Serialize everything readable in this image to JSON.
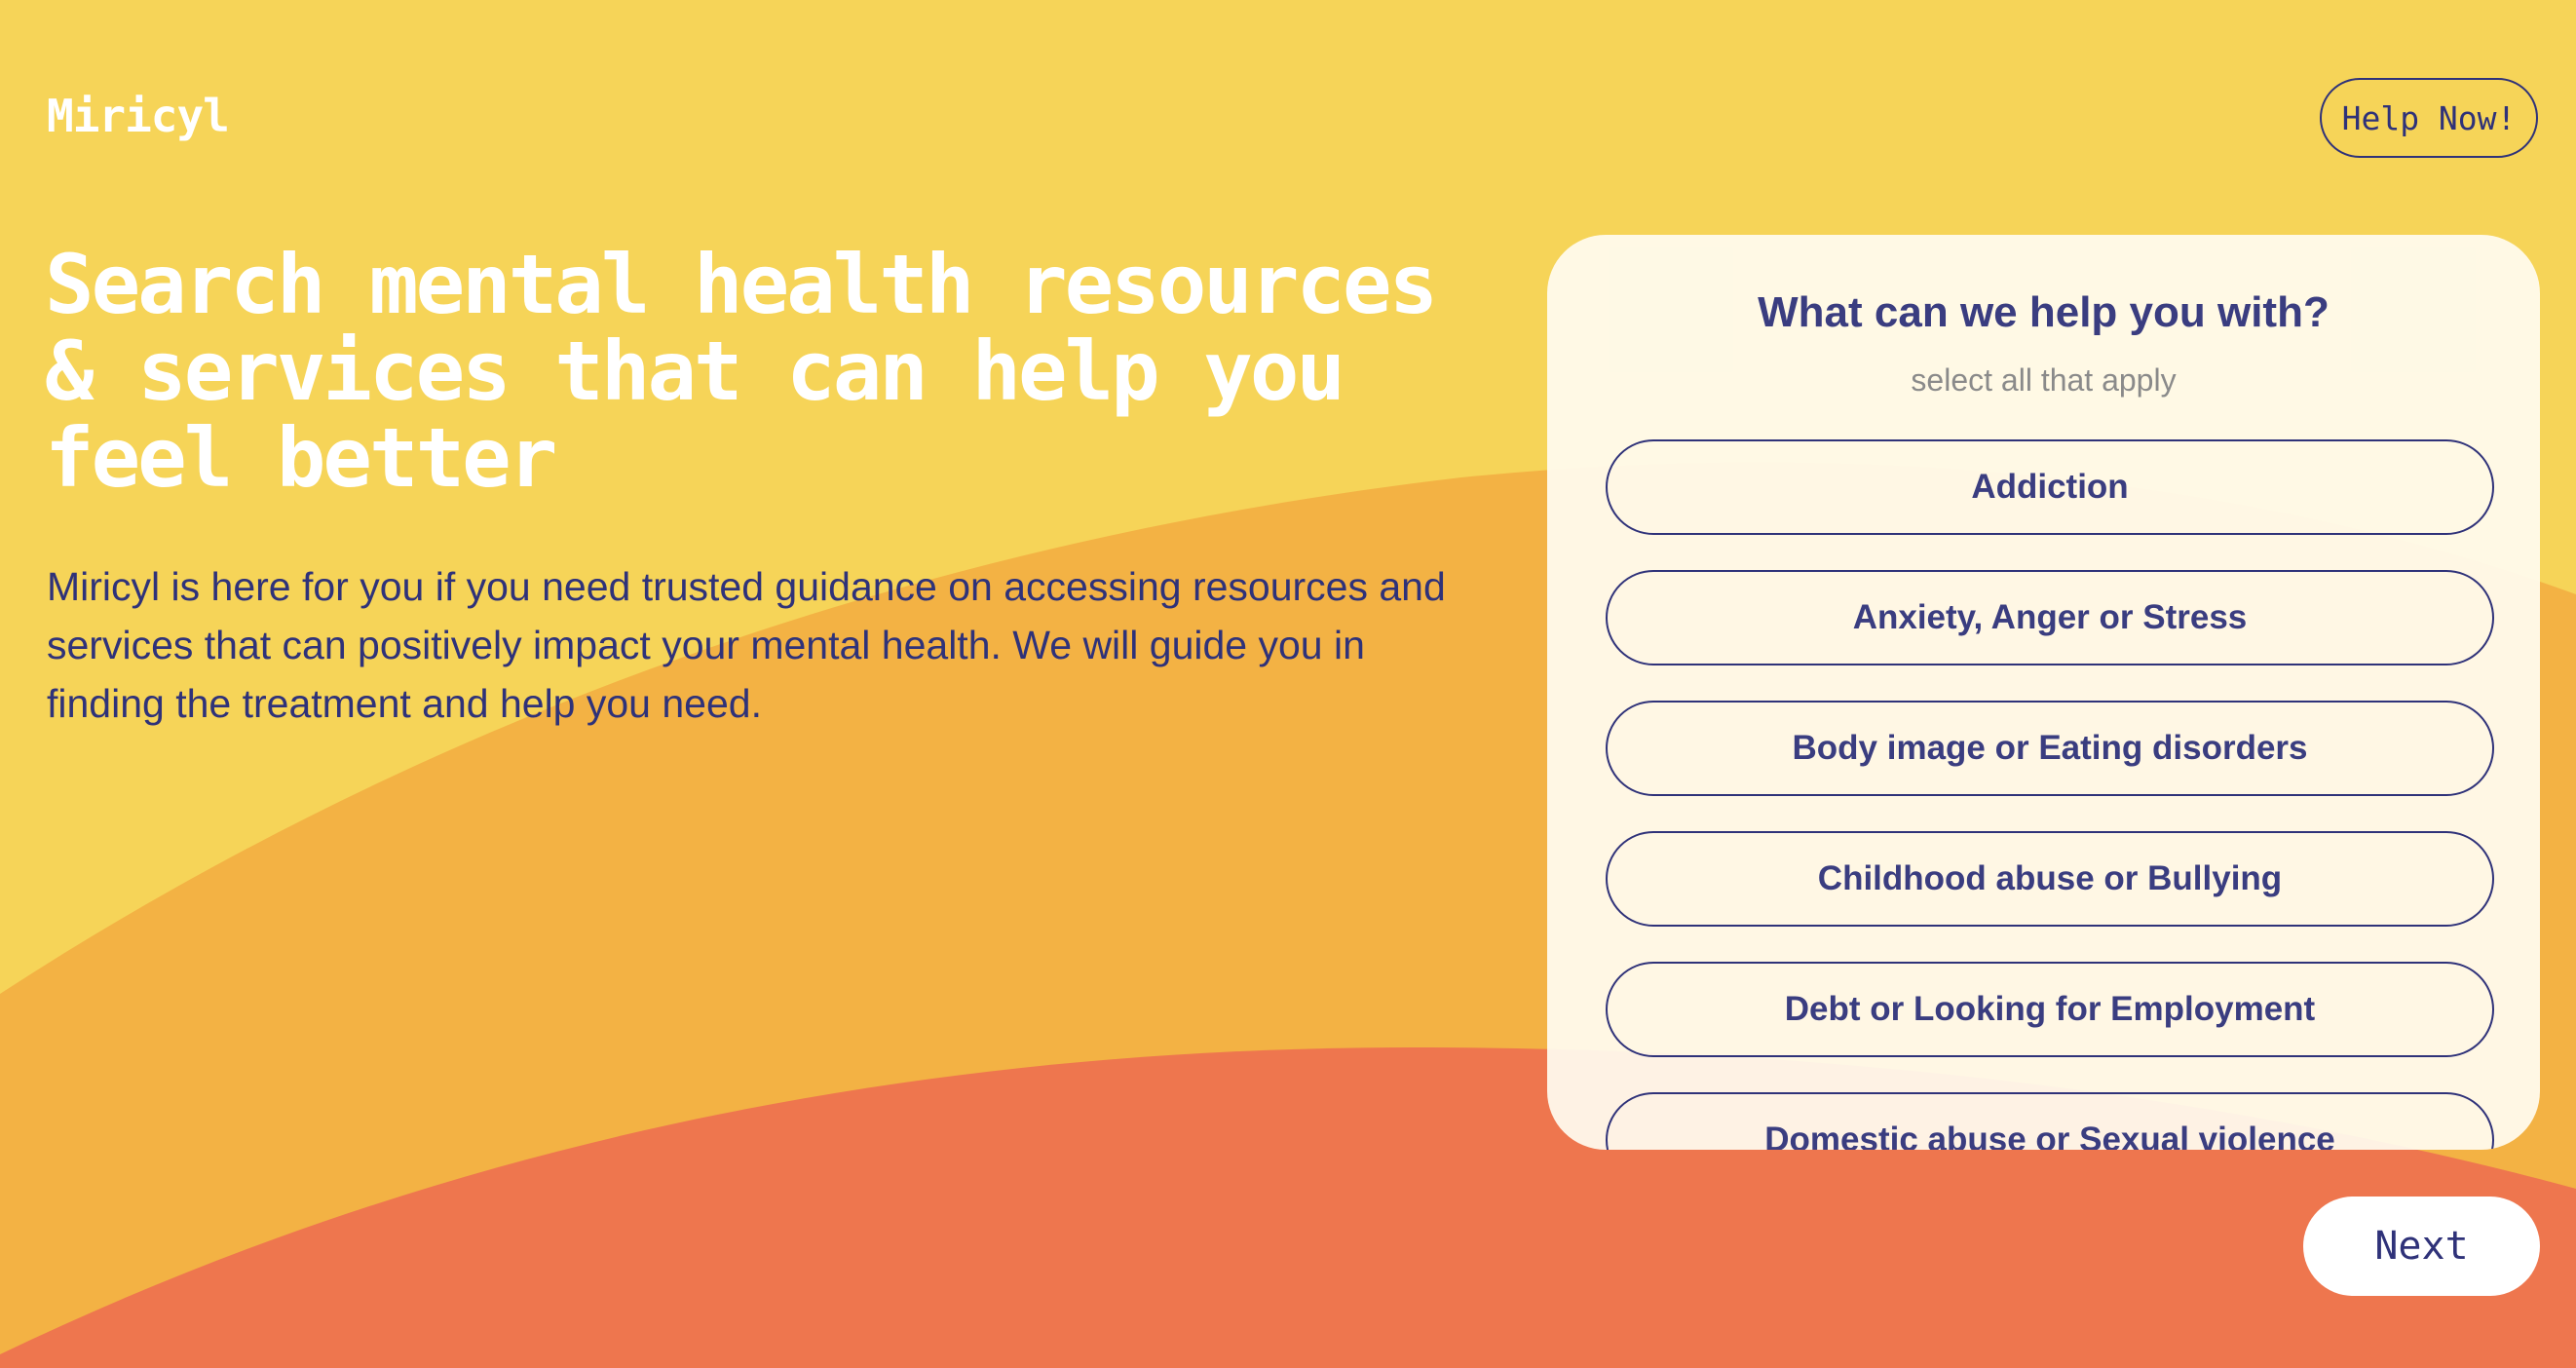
{
  "brand": {
    "logo_text": "Miricyl"
  },
  "header": {
    "help_button_label": "Help Now!"
  },
  "hero": {
    "headline": "Search mental health resources & services that can help you feel better",
    "description": "Miricyl is here for you if you need trusted guidance on accessing resources and services that can positively impact your mental health. We will guide you in finding the treatment and help you need."
  },
  "selection_card": {
    "title": "What can we help you with?",
    "subtitle": "select all that apply",
    "options": [
      {
        "label": "Addiction"
      },
      {
        "label": "Anxiety, Anger or Stress"
      },
      {
        "label": "Body image or Eating disorders"
      },
      {
        "label": "Childhood abuse or Bullying"
      },
      {
        "label": "Debt or Looking for Employment"
      },
      {
        "label": "Domestic abuse or Sexual violence"
      }
    ]
  },
  "footer": {
    "next_button_label": "Next"
  },
  "colors": {
    "background_yellow": "#F6D458",
    "wave_orange": "#F3B244",
    "wave_coral": "#EE764E",
    "text_navy": "#2F3279",
    "card_background": "#FFFCF0",
    "white": "#FFFFFF"
  }
}
